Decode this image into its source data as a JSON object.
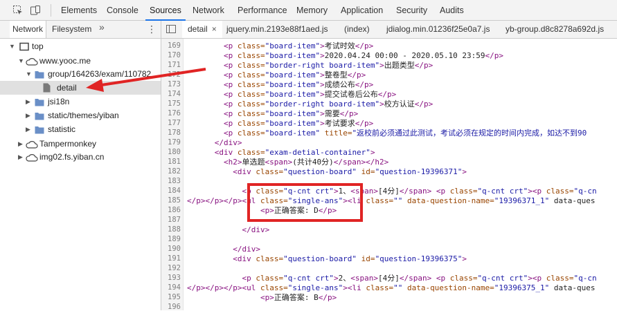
{
  "toolbar": {
    "inspect_icon": "inspect-element-icon",
    "device_icon": "device-toolbar-icon",
    "tabs": [
      "Elements",
      "Console",
      "Sources",
      "Network",
      "Performance",
      "Memory",
      "Application",
      "Security",
      "Audits"
    ],
    "active_tab": "Sources"
  },
  "navigator": {
    "tabs": [
      "Network",
      "Filesystem"
    ],
    "more": "»",
    "menu": "⋮",
    "tree": [
      {
        "label": "top",
        "icon": "frame-icon",
        "expanded": true
      },
      {
        "label": "www.yooc.me",
        "icon": "cloud-icon",
        "expanded": true
      },
      {
        "label": "group/164263/exam/110782",
        "icon": "folder-icon",
        "expanded": true
      },
      {
        "label": "detail",
        "icon": "file-icon",
        "selected": true
      },
      {
        "label": "jsi18n",
        "icon": "folder-icon",
        "expanded": false
      },
      {
        "label": "static/themes/yiban",
        "icon": "folder-icon",
        "expanded": false
      },
      {
        "label": "statistic",
        "icon": "folder-icon",
        "expanded": false
      },
      {
        "label": "Tampermonkey",
        "icon": "cloud-icon",
        "expanded": false
      },
      {
        "label": "img02.fs.yiban.cn",
        "icon": "cloud-icon",
        "expanded": false
      }
    ]
  },
  "editor": {
    "toggle_icon": "navigator-toggle-icon",
    "tabs": [
      {
        "label": "detail",
        "close": "×",
        "active": true
      },
      {
        "label": "jquery.min.2193e88f1aed.js"
      },
      {
        "label": "(index)"
      },
      {
        "label": "jdialog.min.01236f25e0a7.js"
      },
      {
        "label": "yb-group.d8c8278a692d.js"
      }
    ],
    "lines": [
      {
        "n": "169",
        "t": "        <p class=\"board-item\">考试时效</p>"
      },
      {
        "n": "170",
        "t": "        <p class=\"board-item\">2020.04.24 00:00 - 2020.05.10 23:59</p>"
      },
      {
        "n": "171",
        "t": "        <p class=\"border-right board-item\">出题类型</p>"
      },
      {
        "n": "172",
        "t": "        <p class=\"board-item\">整卷型</p>"
      },
      {
        "n": "173",
        "t": "        <p class=\"board-item\">成绩公布</p>"
      },
      {
        "n": "174",
        "t": "        <p class=\"board-item\">提交试卷后公布</p>"
      },
      {
        "n": "175",
        "t": "        <p class=\"border-right board-item\">校方认证</p>"
      },
      {
        "n": "176",
        "t": "        <p class=\"board-item\">需要</p>"
      },
      {
        "n": "177",
        "t": "        <p class=\"board-item\">考试要求</p>"
      },
      {
        "n": "178",
        "t": "        <p class=\"board-item\" title=\"返校前必须通过此测试，考试必须在规定的时间内完成，如达不到90"
      },
      {
        "n": "179",
        "t": "      </div>"
      },
      {
        "n": "180",
        "t": "      <div class=\"exam-detial-container\">"
      },
      {
        "n": "181",
        "t": "        <h2>单选题<span>(共计40分)</span></h2>"
      },
      {
        "n": "182",
        "t": "          <div class=\"question-board\" id=\"question-19396371\">"
      },
      {
        "n": "183",
        "t": ""
      },
      {
        "n": "184",
        "t": "            <p class=\"q-cnt crt\">1、<span>[4分]</span> <p class=\"q-cnt crt\"><p class=\"q-cn"
      },
      {
        "n": "185",
        "t": "</p></p></p><ul class=\"single-ans\"><li class=\"\" data-question-name=\"19396371_1\" data-ques"
      },
      {
        "n": "186",
        "t": "                <p>正确答案: D</p>"
      },
      {
        "n": "187",
        "t": ""
      },
      {
        "n": "188",
        "t": "            </div>"
      },
      {
        "n": "189",
        "t": ""
      },
      {
        "n": "190",
        "t": "          </div>"
      },
      {
        "n": "191",
        "t": "          <div class=\"question-board\" id=\"question-19396375\">"
      },
      {
        "n": "192",
        "t": ""
      },
      {
        "n": "193",
        "t": "            <p class=\"q-cnt crt\">2、<span>[4分]</span> <p class=\"q-cnt crt\"><p class=\"q-cn"
      },
      {
        "n": "194",
        "t": "</p></p></p><ul class=\"single-ans\"><li class=\"\" data-question-name=\"19396375_1\" data-ques"
      },
      {
        "n": "195",
        "t": "                <p>正确答案: B</p>"
      },
      {
        "n": "196",
        "t": ""
      }
    ]
  },
  "annotation": {
    "box_color": "#e02424",
    "arrow_color": "#e02424"
  }
}
